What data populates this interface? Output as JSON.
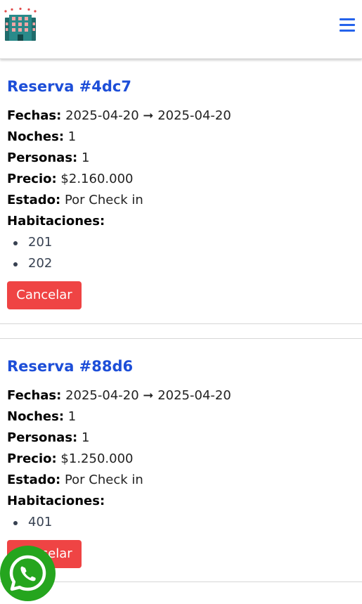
{
  "header": {
    "logo_icon": "hotel-building-icon",
    "menu_icon": "hamburger-menu-icon",
    "accent_color": "#2563eb"
  },
  "labels": {
    "fechas": "Fechas:",
    "noches": "Noches:",
    "personas": "Personas:",
    "precio": "Precio:",
    "estado": "Estado:",
    "habitaciones": "Habitaciones:"
  },
  "reservations": [
    {
      "title": "Reserva #4dc7",
      "dates": "2025-04-20 ➞ 2025-04-20",
      "nights": "1",
      "people": "1",
      "price": "$2.160.000",
      "status": "Por Check in",
      "rooms": [
        "201",
        "202"
      ],
      "cancel_label": "Cancelar"
    },
    {
      "title": "Reserva #88d6",
      "dates": "2025-04-20 ➞ 2025-04-20",
      "nights": "1",
      "people": "1",
      "price": "$1.250.000",
      "status": "Por Check in",
      "rooms": [
        "401"
      ],
      "cancel_label": "Cancelar"
    }
  ],
  "floating": {
    "whatsapp_icon": "whatsapp-icon",
    "whatsapp_color": "#25a51e"
  },
  "colors": {
    "title": "#1d4ed8",
    "danger": "#ef4444"
  }
}
